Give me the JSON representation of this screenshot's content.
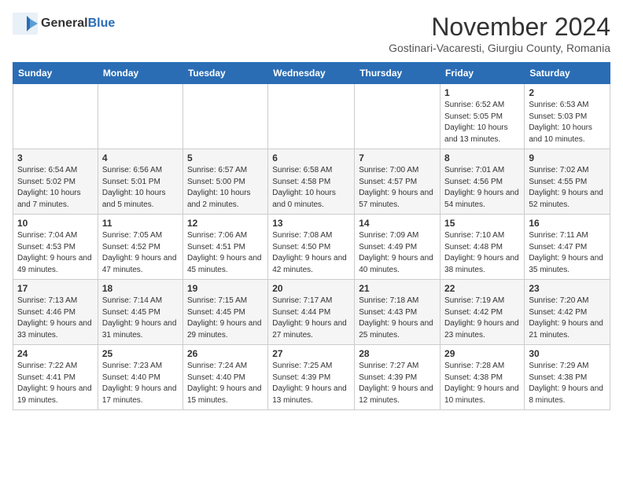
{
  "header": {
    "logo_general": "General",
    "logo_blue": "Blue",
    "month_year": "November 2024",
    "location": "Gostinari-Vacaresti, Giurgiu County, Romania"
  },
  "weekdays": [
    "Sunday",
    "Monday",
    "Tuesday",
    "Wednesday",
    "Thursday",
    "Friday",
    "Saturday"
  ],
  "weeks": [
    [
      {
        "day": "",
        "info": ""
      },
      {
        "day": "",
        "info": ""
      },
      {
        "day": "",
        "info": ""
      },
      {
        "day": "",
        "info": ""
      },
      {
        "day": "",
        "info": ""
      },
      {
        "day": "1",
        "info": "Sunrise: 6:52 AM\nSunset: 5:05 PM\nDaylight: 10 hours and 13 minutes."
      },
      {
        "day": "2",
        "info": "Sunrise: 6:53 AM\nSunset: 5:03 PM\nDaylight: 10 hours and 10 minutes."
      }
    ],
    [
      {
        "day": "3",
        "info": "Sunrise: 6:54 AM\nSunset: 5:02 PM\nDaylight: 10 hours and 7 minutes."
      },
      {
        "day": "4",
        "info": "Sunrise: 6:56 AM\nSunset: 5:01 PM\nDaylight: 10 hours and 5 minutes."
      },
      {
        "day": "5",
        "info": "Sunrise: 6:57 AM\nSunset: 5:00 PM\nDaylight: 10 hours and 2 minutes."
      },
      {
        "day": "6",
        "info": "Sunrise: 6:58 AM\nSunset: 4:58 PM\nDaylight: 10 hours and 0 minutes."
      },
      {
        "day": "7",
        "info": "Sunrise: 7:00 AM\nSunset: 4:57 PM\nDaylight: 9 hours and 57 minutes."
      },
      {
        "day": "8",
        "info": "Sunrise: 7:01 AM\nSunset: 4:56 PM\nDaylight: 9 hours and 54 minutes."
      },
      {
        "day": "9",
        "info": "Sunrise: 7:02 AM\nSunset: 4:55 PM\nDaylight: 9 hours and 52 minutes."
      }
    ],
    [
      {
        "day": "10",
        "info": "Sunrise: 7:04 AM\nSunset: 4:53 PM\nDaylight: 9 hours and 49 minutes."
      },
      {
        "day": "11",
        "info": "Sunrise: 7:05 AM\nSunset: 4:52 PM\nDaylight: 9 hours and 47 minutes."
      },
      {
        "day": "12",
        "info": "Sunrise: 7:06 AM\nSunset: 4:51 PM\nDaylight: 9 hours and 45 minutes."
      },
      {
        "day": "13",
        "info": "Sunrise: 7:08 AM\nSunset: 4:50 PM\nDaylight: 9 hours and 42 minutes."
      },
      {
        "day": "14",
        "info": "Sunrise: 7:09 AM\nSunset: 4:49 PM\nDaylight: 9 hours and 40 minutes."
      },
      {
        "day": "15",
        "info": "Sunrise: 7:10 AM\nSunset: 4:48 PM\nDaylight: 9 hours and 38 minutes."
      },
      {
        "day": "16",
        "info": "Sunrise: 7:11 AM\nSunset: 4:47 PM\nDaylight: 9 hours and 35 minutes."
      }
    ],
    [
      {
        "day": "17",
        "info": "Sunrise: 7:13 AM\nSunset: 4:46 PM\nDaylight: 9 hours and 33 minutes."
      },
      {
        "day": "18",
        "info": "Sunrise: 7:14 AM\nSunset: 4:45 PM\nDaylight: 9 hours and 31 minutes."
      },
      {
        "day": "19",
        "info": "Sunrise: 7:15 AM\nSunset: 4:45 PM\nDaylight: 9 hours and 29 minutes."
      },
      {
        "day": "20",
        "info": "Sunrise: 7:17 AM\nSunset: 4:44 PM\nDaylight: 9 hours and 27 minutes."
      },
      {
        "day": "21",
        "info": "Sunrise: 7:18 AM\nSunset: 4:43 PM\nDaylight: 9 hours and 25 minutes."
      },
      {
        "day": "22",
        "info": "Sunrise: 7:19 AM\nSunset: 4:42 PM\nDaylight: 9 hours and 23 minutes."
      },
      {
        "day": "23",
        "info": "Sunrise: 7:20 AM\nSunset: 4:42 PM\nDaylight: 9 hours and 21 minutes."
      }
    ],
    [
      {
        "day": "24",
        "info": "Sunrise: 7:22 AM\nSunset: 4:41 PM\nDaylight: 9 hours and 19 minutes."
      },
      {
        "day": "25",
        "info": "Sunrise: 7:23 AM\nSunset: 4:40 PM\nDaylight: 9 hours and 17 minutes."
      },
      {
        "day": "26",
        "info": "Sunrise: 7:24 AM\nSunset: 4:40 PM\nDaylight: 9 hours and 15 minutes."
      },
      {
        "day": "27",
        "info": "Sunrise: 7:25 AM\nSunset: 4:39 PM\nDaylight: 9 hours and 13 minutes."
      },
      {
        "day": "28",
        "info": "Sunrise: 7:27 AM\nSunset: 4:39 PM\nDaylight: 9 hours and 12 minutes."
      },
      {
        "day": "29",
        "info": "Sunrise: 7:28 AM\nSunset: 4:38 PM\nDaylight: 9 hours and 10 minutes."
      },
      {
        "day": "30",
        "info": "Sunrise: 7:29 AM\nSunset: 4:38 PM\nDaylight: 9 hours and 8 minutes."
      }
    ]
  ]
}
